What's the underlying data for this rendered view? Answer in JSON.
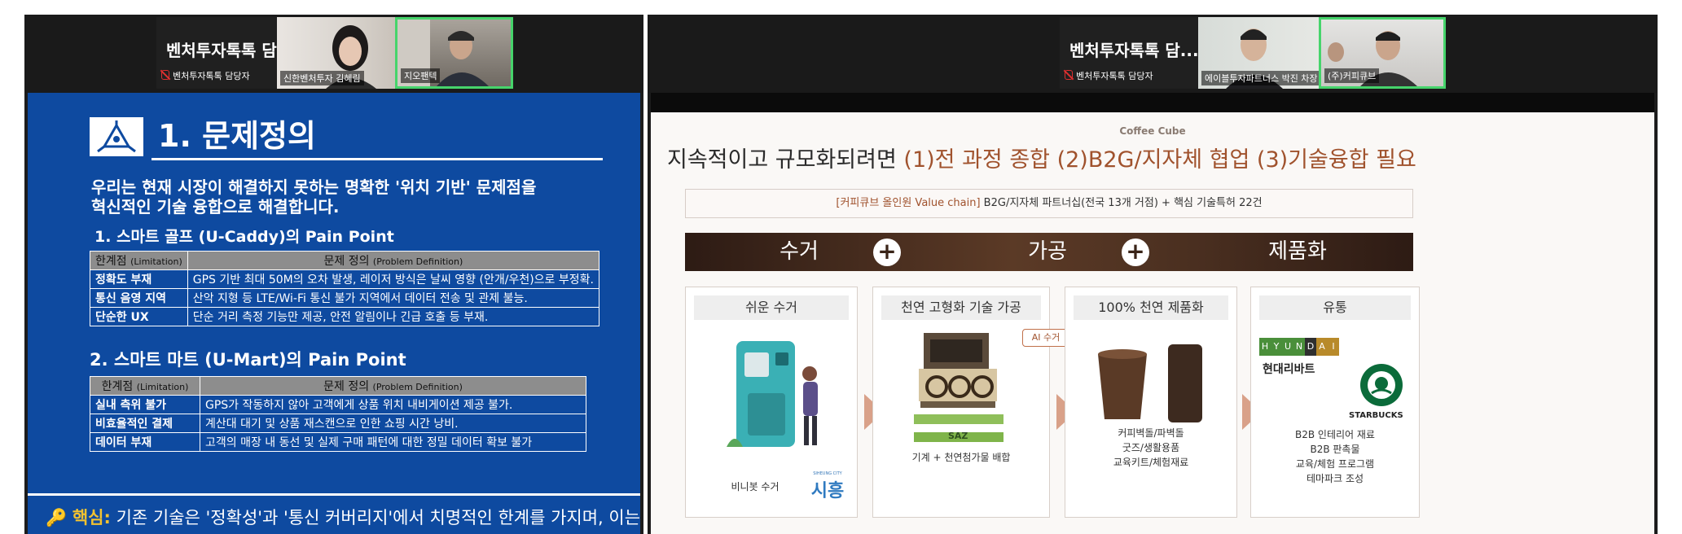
{
  "left_meeting": {
    "host_card": {
      "name": "벤처투자톡톡 담...",
      "label": "벤처투자톡톡 담당자"
    },
    "tiles": [
      {
        "label": "신한벤처투자 김혜림"
      },
      {
        "label": "지오팬텍"
      }
    ],
    "slide": {
      "title": "1. 문제정의",
      "intro_line1": "우리는 현재 시장이 해결하지 못하는 명확한 '위치 기반' 문제점을",
      "intro_line2": "혁신적인 기술 융합으로 해결합니다.",
      "section1": {
        "heading": "1. 스마트 골프 (U-Caddy)의 Pain Point",
        "col1": "한계점",
        "col1_en": "(Limitation)",
        "col2": "문제 정의",
        "col2_en": "(Problem Definition)",
        "rows": [
          {
            "k": "정확도 부재",
            "v": "GPS 기반 최대 50M의 오차 발생, 레이저 방식은 날씨 영향 (안개/우천)으로 부정확."
          },
          {
            "k": "통신 음영 지역",
            "v": "산악 지형 등 LTE/Wi-Fi 통신 불가 지역에서 데이터 전송 및 관제 불능."
          },
          {
            "k": "단순한 UX",
            "v": "단순 거리 측정 기능만 제공, 안전 알림이나 긴급 호출 등 부재."
          }
        ]
      },
      "section2": {
        "heading": "2. 스마트 마트 (U-Mart)의 Pain Point",
        "col1": "한계점",
        "col1_en": "(Limitation)",
        "col2": "문제 정의",
        "col2_en": "(Problem Definition)",
        "rows": [
          {
            "k": "실내 측위 불가",
            "v": "GPS가 작동하지 않아 고객에게 상품 위치 내비게이션 제공 불가."
          },
          {
            "k": "비효율적인 결제",
            "v": "계산대 대기 및 상품 재스캔으로 인한 쇼핑 시간 낭비."
          },
          {
            "k": "데이터 부재",
            "v": "고객의 매장 내 동선 및 실제 구매 패턴에 대한 정밀 데이터 확보 불가"
          }
        ]
      },
      "core_label": "핵심:",
      "core_text": "기존 기술은 '정확성'과 '통신 커버리지'에서 치명적인 한계를 가지며, 이는"
    }
  },
  "right_meeting": {
    "host_card": {
      "name": "벤처투자톡톡 담...",
      "label": "벤처투자톡톡 담당자"
    },
    "tiles": [
      {
        "label": "에이블투자파트너스 박진 차장"
      },
      {
        "label": "(주)커피큐브"
      }
    ],
    "slide": {
      "brand": "Coffee Cube",
      "headline_plain": "지속적이고 규모화되려면 ",
      "headline_accent": "(1)전 과정 종합 (2)B2G/지자체 협업 (3)기술융합 필요",
      "value_chain_tag": "[커피큐브 올인원 Value chain]",
      "value_chain_text": " B2G/지자체 파트너십(전국 13개 거점) + 핵심 기술특허 22건",
      "stages": [
        "수거",
        "가공",
        "제품화"
      ],
      "cards": [
        {
          "title": "쉬운 수거",
          "caption": "비니봇 수거",
          "logo": "시흥",
          "logo_small": "SIHEUNG CITY"
        },
        {
          "title": "천연 고형화 기술 가공",
          "caption": "기계 + 천연첨가물 배합",
          "sticker": "SAZ"
        },
        {
          "title": "100% 천연 제품화",
          "caption_lines": [
            "커피벽돌/파벽돌",
            "굿즈/생활용품",
            "교육키트/체험재료"
          ]
        },
        {
          "title": "유통",
          "brand1_letters": [
            "H",
            "Y",
            "U",
            "N",
            "D",
            "A",
            "I"
          ],
          "brand1_name": "현대리바트",
          "brand2": "STARBUCKS",
          "caption_lines": [
            "B2B 인테리어 재료",
            "B2B 판촉물",
            "교육/체험 프로그램",
            "테마파크 조성"
          ]
        }
      ],
      "ai_tag": "AI 수거"
    }
  },
  "colors": {
    "slide_blue": "#0e4aa0",
    "brown": "#4a2f20",
    "accent_brown": "#a0522d",
    "speaker_green": "#46d46b"
  },
  "icons": [
    "mic-muted-icon",
    "logo-triangle-icon",
    "key-icon",
    "plus-icon",
    "chevron-right-icon"
  ]
}
